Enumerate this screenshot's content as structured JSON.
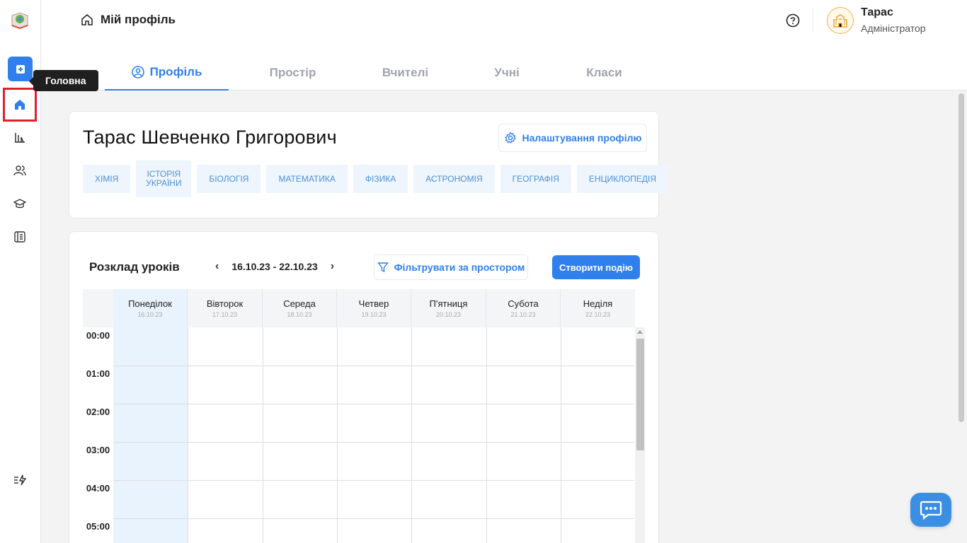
{
  "sidebar": {
    "tooltip": "Головна",
    "items": [
      {
        "name": "add-icon"
      },
      {
        "name": "home-icon"
      },
      {
        "name": "stats-icon"
      },
      {
        "name": "users-icon"
      },
      {
        "name": "graduation-cap-icon"
      },
      {
        "name": "journal-icon"
      },
      {
        "name": "updates-icon"
      }
    ]
  },
  "header": {
    "breadcrumb": "Мій профіль",
    "user": {
      "name": "Тарас",
      "role": "Адміністратор"
    }
  },
  "tabs": [
    {
      "label": "Профіль",
      "active": true
    },
    {
      "label": "Простір",
      "active": false
    },
    {
      "label": "Вчителі",
      "active": false
    },
    {
      "label": "Учні",
      "active": false
    },
    {
      "label": "Класи",
      "active": false
    }
  ],
  "profile": {
    "full_name": "Тарас Шевченко Григорович",
    "settings_label": "Налаштування профілю",
    "subjects": [
      "ХІМІЯ",
      "ІСТОРІЯ УКРАЇНИ",
      "БІОЛОГІЯ",
      "МАТЕМАТИКА",
      "ФІЗИКА",
      "АСТРОНОМІЯ",
      "ГЕОГРАФІЯ",
      "ЕНЦИКЛОПЕДІЯ"
    ]
  },
  "schedule": {
    "title": "Розклад уроків",
    "range": "16.10.23 - 22.10.23",
    "filter_label": "Фільтрувати за простором",
    "create_label": "Створити подію",
    "days": [
      {
        "name": "Понеділок",
        "date": "16.10.23",
        "today": true
      },
      {
        "name": "Вівторок",
        "date": "17.10.23",
        "today": false
      },
      {
        "name": "Середа",
        "date": "18.10.23",
        "today": false
      },
      {
        "name": "Четвер",
        "date": "19.10.23",
        "today": false
      },
      {
        "name": "П'ятниця",
        "date": "20.10.23",
        "today": false
      },
      {
        "name": "Субота",
        "date": "21.10.23",
        "today": false
      },
      {
        "name": "Неділя",
        "date": "22.10.23",
        "today": false
      }
    ],
    "hours": [
      "00:00",
      "01:00",
      "02:00",
      "03:00",
      "04:00",
      "05:00"
    ]
  },
  "colors": {
    "accent": "#2f80ed",
    "highlight": "#e0202b",
    "today": "#e8f3fd"
  }
}
